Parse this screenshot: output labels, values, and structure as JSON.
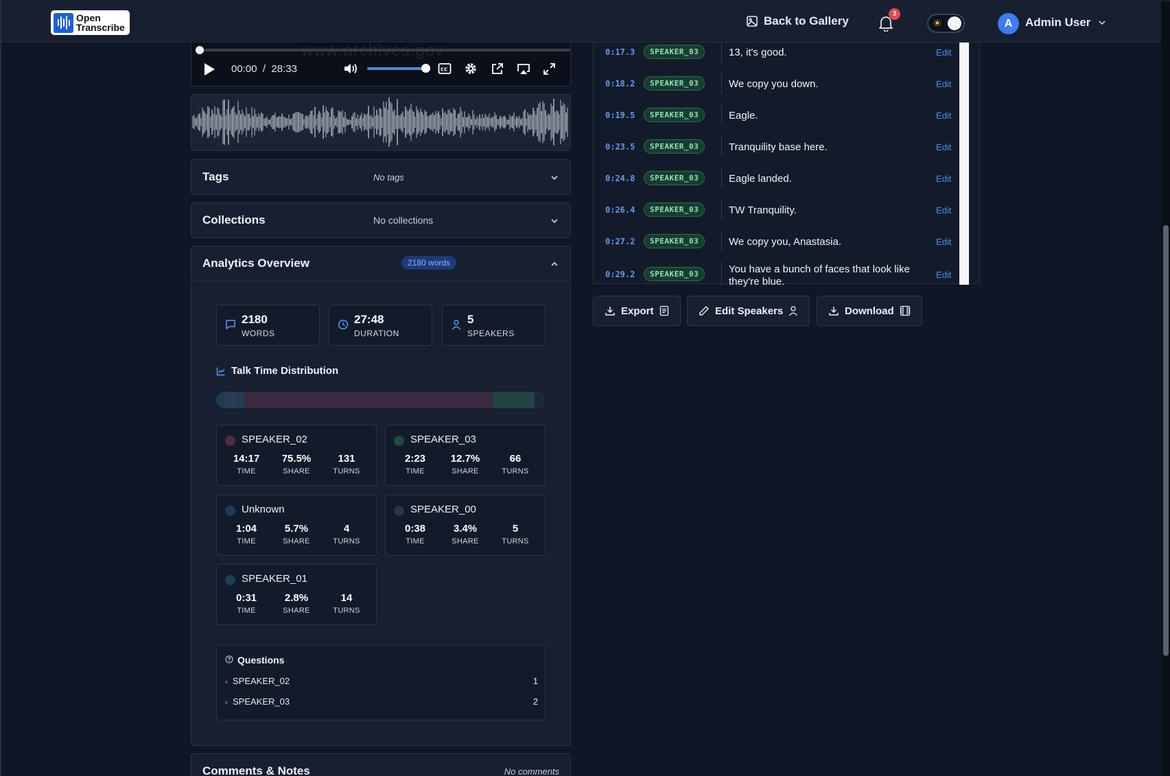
{
  "header": {
    "logo": {
      "line1": "Open",
      "line2": "Transcribe"
    },
    "back_to_gallery": "Back to Gallery",
    "notification_count": "3",
    "user_initial": "A",
    "user_name": "Admin User"
  },
  "player": {
    "watermark": "www.archives.gov",
    "current_time": "00:00",
    "separator": "/",
    "total_time": "28:33",
    "progress": 0.0,
    "volume": 1.0
  },
  "tags": {
    "title": "Tags",
    "value": "No tags"
  },
  "collections": {
    "title": "Collections",
    "value": "No collections"
  },
  "analytics": {
    "title": "Analytics Overview",
    "words_badge": "2180 words",
    "stats": [
      {
        "icon": "message-icon",
        "value": "2180",
        "label": "WORDS"
      },
      {
        "icon": "clock-icon",
        "value": "27:48",
        "label": "DURATION"
      },
      {
        "icon": "user-icon",
        "value": "5",
        "label": "SPEAKERS"
      }
    ],
    "talk_time_title": "Talk Time Distribution",
    "talk_time_segments": [
      {
        "speaker": "SPEAKER_01",
        "share": 2.8,
        "color": "#1f3a55"
      },
      {
        "speaker": "SPEAKER_00",
        "share": 3.4,
        "color": "#2c3a52"
      },
      {
        "speaker": "Unknown",
        "share": 2.2,
        "color": "#223c5c"
      },
      {
        "speaker": "SPEAKER_02",
        "share": 75.5,
        "color": "#3b2a3f"
      },
      {
        "speaker": "SPEAKER_03",
        "share": 12.7,
        "color": "#24453f"
      }
    ],
    "time_label": "TIME",
    "share_label": "SHARE",
    "turns_label": "TURNS",
    "speakers": [
      {
        "name": "SPEAKER_02",
        "time": "14:17",
        "share": "75.5%",
        "turns": "131",
        "color": "#4a2d3f"
      },
      {
        "name": "SPEAKER_03",
        "time": "2:23",
        "share": "12.7%",
        "turns": "66",
        "color": "#1f4a40"
      },
      {
        "name": "Unknown",
        "time": "1:04",
        "share": "5.7%",
        "turns": "4",
        "color": "#1d3a5a"
      },
      {
        "name": "SPEAKER_00",
        "time": "0:38",
        "share": "3.4%",
        "turns": "5",
        "color": "#2e3447"
      },
      {
        "name": "SPEAKER_01",
        "time": "0:31",
        "share": "2.8%",
        "turns": "14",
        "color": "#1f3f52"
      }
    ],
    "questions": {
      "title": "Questions",
      "rows": [
        {
          "speaker": "SPEAKER_02",
          "count": "1"
        },
        {
          "speaker": "SPEAKER_03",
          "count": "2"
        }
      ]
    }
  },
  "comments": {
    "title": "Comments & Notes",
    "value": "No comments"
  },
  "transcript": {
    "edit_label": "Edit",
    "rows": [
      {
        "time": "0:17.3",
        "speaker": "SPEAKER_03",
        "text": "13, it's good."
      },
      {
        "time": "0:18.2",
        "speaker": "SPEAKER_03",
        "text": "We copy you down."
      },
      {
        "time": "0:19.5",
        "speaker": "SPEAKER_03",
        "text": "Eagle."
      },
      {
        "time": "0:23.5",
        "speaker": "SPEAKER_03",
        "text": "Tranquility base here."
      },
      {
        "time": "0:24.8",
        "speaker": "SPEAKER_03",
        "text": "Eagle landed."
      },
      {
        "time": "0:26.4",
        "speaker": "SPEAKER_03",
        "text": "TW Tranquility."
      },
      {
        "time": "0:27.2",
        "speaker": "SPEAKER_03",
        "text": "We copy you, Anastasia."
      },
      {
        "time": "0:29.2",
        "speaker": "SPEAKER_03",
        "text": "You have a bunch of faces that look like they're blue."
      }
    ]
  },
  "actions": {
    "export": "Export",
    "edit_speakers": "Edit Speakers",
    "download": "Download"
  }
}
